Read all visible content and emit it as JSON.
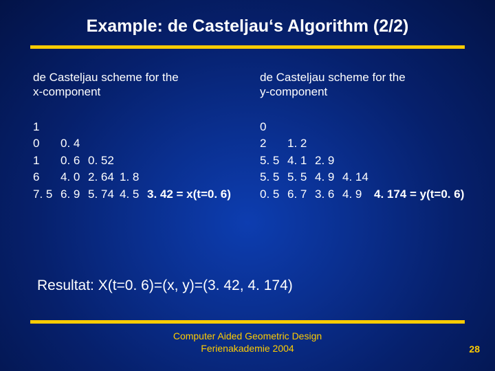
{
  "title": "Example: de Casteljau‘s Algorithm (2/2)",
  "left": {
    "desc1": "de Casteljau scheme for the",
    "desc2": "x-component",
    "rows": [
      [
        "1"
      ],
      [
        "0",
        "0. 4"
      ],
      [
        "1",
        "0. 6",
        "0. 52"
      ],
      [
        "6",
        "4. 0",
        "2. 64",
        "1. 8"
      ],
      [
        "7. 5",
        "6. 9",
        "5. 74",
        "4. 5",
        "3. 42 = x(t=0. 6)"
      ]
    ]
  },
  "right": {
    "desc1": "de Casteljau scheme for the",
    "desc2": "y-component",
    "rows": [
      [
        "0"
      ],
      [
        "2",
        "1. 2"
      ],
      [
        "5. 5",
        "4. 1",
        "2. 9"
      ],
      [
        "5. 5",
        "5. 5",
        "4. 9",
        "4. 14"
      ],
      [
        "0. 5",
        "6. 7",
        "3. 6",
        "4. 9",
        "4. 174 = y(t=0. 6)"
      ]
    ]
  },
  "result": "Resultat:  X(t=0. 6)=(x, y)=(3. 42, 4. 174)",
  "footer1": "Computer Aided Geometric Design",
  "footer2": "Ferienakademie 2004",
  "pagenum": "28"
}
